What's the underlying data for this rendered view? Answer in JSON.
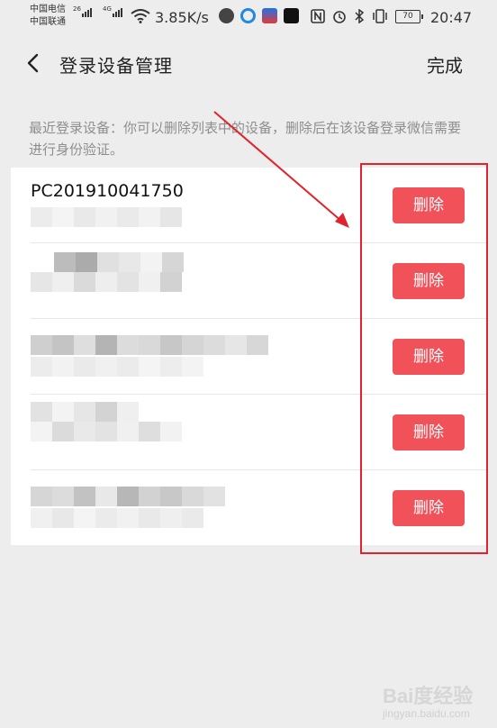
{
  "status_bar": {
    "carrier1": "中国电信",
    "carrier2": "中国联通",
    "net1": "26",
    "net2": "4G",
    "speed": "3.85K/s",
    "battery": "70",
    "time": "20:47"
  },
  "header": {
    "title": "登录设备管理",
    "done_label": "完成"
  },
  "hint": "最近登录设备：你可以删除列表中的设备，删除后在该设备登录微信需要进行身份验证。",
  "devices": [
    {
      "name": "PC201910041750",
      "delete_label": "删除"
    },
    {
      "name": "",
      "delete_label": "删除"
    },
    {
      "name": "",
      "delete_label": "删除"
    },
    {
      "name": "",
      "delete_label": "删除"
    },
    {
      "name": "",
      "delete_label": "删除"
    }
  ],
  "watermark": {
    "brand": "Bai度经验",
    "url": "jingyan.baidu.com"
  },
  "colors": {
    "delete_button": "#f1525a",
    "highlight_box": "#e0242d",
    "background": "#ededed"
  }
}
